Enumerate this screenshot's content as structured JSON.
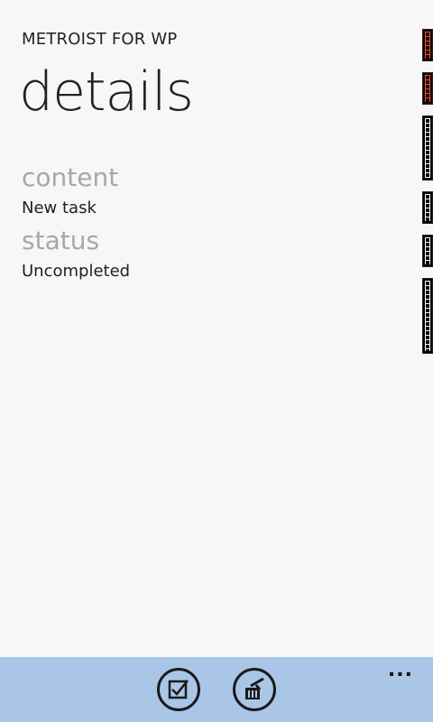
{
  "app": {
    "title": "METROIST FOR WP"
  },
  "page": {
    "title": "details"
  },
  "fields": {
    "content_label": "content",
    "content_value": "New task",
    "status_label": "status",
    "status_value": "Uncompleted"
  },
  "appbar": {
    "buttons": [
      {
        "icon": "complete-checkbox-icon"
      },
      {
        "icon": "delete-trash-icon"
      }
    ],
    "more": "..."
  },
  "colors": {
    "background": "#f7f7f7",
    "appbar": "#a9c6e7",
    "label_gray": "#a8a8a8",
    "counter_accent": "#e2572c"
  }
}
